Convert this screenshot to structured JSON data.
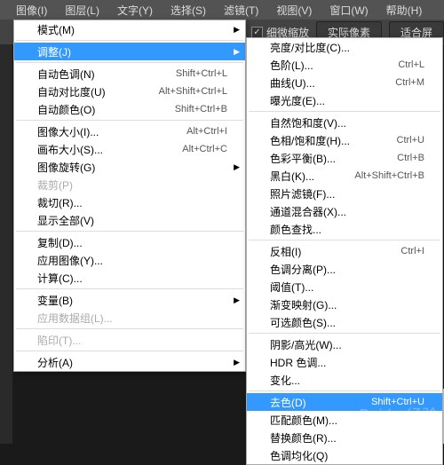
{
  "menubar": [
    {
      "label": "图像(I)"
    },
    {
      "label": "图层(L)"
    },
    {
      "label": "文字(Y)"
    },
    {
      "label": "选择(S)"
    },
    {
      "label": "滤镜(T)"
    },
    {
      "label": "视图(V)"
    },
    {
      "label": "窗口(W)"
    },
    {
      "label": "帮助(H)"
    }
  ],
  "toolbar": {
    "check_label": "细微缩放",
    "btn1": "实际像素",
    "btn2": "适合屏"
  },
  "menu1": [
    {
      "type": "item",
      "label": "模式(M)",
      "submenu": true
    },
    {
      "type": "sep"
    },
    {
      "type": "item",
      "label": "调整(J)",
      "submenu": true,
      "hl": true
    },
    {
      "type": "sep"
    },
    {
      "type": "item",
      "label": "自动色调(N)",
      "shortcut": "Shift+Ctrl+L"
    },
    {
      "type": "item",
      "label": "自动对比度(U)",
      "shortcut": "Alt+Shift+Ctrl+L"
    },
    {
      "type": "item",
      "label": "自动颜色(O)",
      "shortcut": "Shift+Ctrl+B"
    },
    {
      "type": "sep"
    },
    {
      "type": "item",
      "label": "图像大小(I)...",
      "shortcut": "Alt+Ctrl+I"
    },
    {
      "type": "item",
      "label": "画布大小(S)...",
      "shortcut": "Alt+Ctrl+C"
    },
    {
      "type": "item",
      "label": "图像旋转(G)",
      "submenu": true
    },
    {
      "type": "item",
      "label": "裁剪(P)",
      "disabled": true
    },
    {
      "type": "item",
      "label": "裁切(R)..."
    },
    {
      "type": "item",
      "label": "显示全部(V)"
    },
    {
      "type": "sep"
    },
    {
      "type": "item",
      "label": "复制(D)..."
    },
    {
      "type": "item",
      "label": "应用图像(Y)..."
    },
    {
      "type": "item",
      "label": "计算(C)..."
    },
    {
      "type": "sep"
    },
    {
      "type": "item",
      "label": "变量(B)",
      "submenu": true
    },
    {
      "type": "item",
      "label": "应用数据组(L)...",
      "disabled": true
    },
    {
      "type": "sep"
    },
    {
      "type": "item",
      "label": "陷印(T)...",
      "disabled": true
    },
    {
      "type": "sep"
    },
    {
      "type": "item",
      "label": "分析(A)",
      "submenu": true
    }
  ],
  "menu2": [
    {
      "type": "item",
      "label": "亮度/对比度(C)..."
    },
    {
      "type": "item",
      "label": "色阶(L)...",
      "shortcut": "Ctrl+L"
    },
    {
      "type": "item",
      "label": "曲线(U)...",
      "shortcut": "Ctrl+M"
    },
    {
      "type": "item",
      "label": "曝光度(E)..."
    },
    {
      "type": "sep"
    },
    {
      "type": "item",
      "label": "自然饱和度(V)..."
    },
    {
      "type": "item",
      "label": "色相/饱和度(H)...",
      "shortcut": "Ctrl+U"
    },
    {
      "type": "item",
      "label": "色彩平衡(B)...",
      "shortcut": "Ctrl+B"
    },
    {
      "type": "item",
      "label": "黑白(K)...",
      "shortcut": "Alt+Shift+Ctrl+B"
    },
    {
      "type": "item",
      "label": "照片滤镜(F)..."
    },
    {
      "type": "item",
      "label": "通道混合器(X)..."
    },
    {
      "type": "item",
      "label": "颜色查找..."
    },
    {
      "type": "sep"
    },
    {
      "type": "item",
      "label": "反相(I)",
      "shortcut": "Ctrl+I"
    },
    {
      "type": "item",
      "label": "色调分离(P)..."
    },
    {
      "type": "item",
      "label": "阈值(T)..."
    },
    {
      "type": "item",
      "label": "渐变映射(G)..."
    },
    {
      "type": "item",
      "label": "可选颜色(S)..."
    },
    {
      "type": "sep"
    },
    {
      "type": "item",
      "label": "阴影/高光(W)..."
    },
    {
      "type": "item",
      "label": "HDR 色调..."
    },
    {
      "type": "item",
      "label": "变化..."
    },
    {
      "type": "sep"
    },
    {
      "type": "item",
      "label": "去色(D)",
      "shortcut": "Shift+Ctrl+U",
      "hl": true
    },
    {
      "type": "item",
      "label": "匹配颜色(M)..."
    },
    {
      "type": "item",
      "label": "替换颜色(R)..."
    },
    {
      "type": "item",
      "label": "色调均化(Q)"
    }
  ],
  "watermark": "Baidu 经验"
}
